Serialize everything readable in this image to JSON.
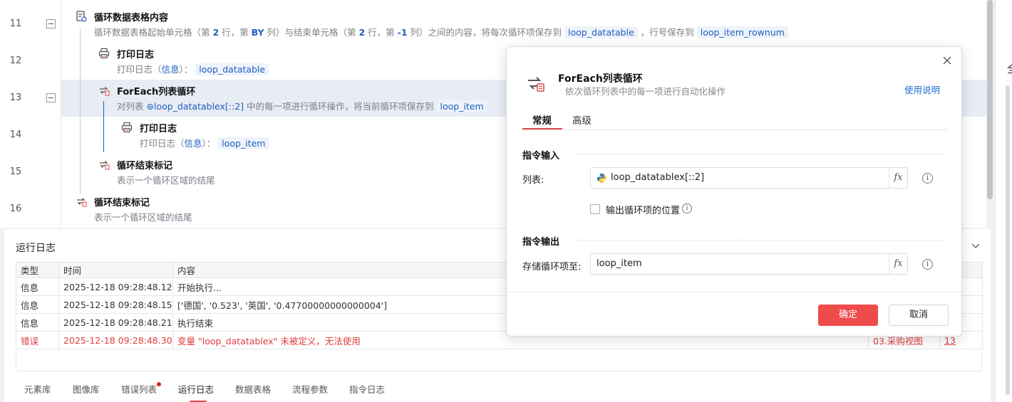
{
  "editor": {
    "line_numbers": [
      "11",
      "12",
      "13",
      "14",
      "15",
      "16"
    ],
    "steps": [
      {
        "title": "循环数据表格内容",
        "desc_parts": [
          "循环数据表格起始单元格（第 ",
          "2",
          " 行，第 ",
          "BY",
          " 列）与结束单元格（第 ",
          "2",
          " 行，第 ",
          "-1",
          " 列）之间的内容，将每次循环项保存到 ",
          "loop_datatable",
          " ，行号保存到 ",
          "loop_item_rownum"
        ]
      },
      {
        "title": "打印日志",
        "desc_prefix": "打印日志（",
        "desc_kw": "信息",
        "desc_mid": "）：",
        "desc_tag": "loop_datatable"
      },
      {
        "title": "ForEach列表循环",
        "desc_prefix": "对列表",
        "desc_tag1": "loop_datatablex[::2]",
        "desc_mid": " 中的每一项进行循环操作，将当前循环项保存到",
        "desc_tag2": "loop_item"
      },
      {
        "title": "打印日志",
        "desc_prefix": "打印日志（",
        "desc_kw": "信息",
        "desc_mid": "）：",
        "desc_tag": "loop_item"
      },
      {
        "title": "循环结束标记",
        "desc": "表示一个循环区域的结尾"
      },
      {
        "title": "循环结束标记",
        "desc": "表示一个循环区域的结尾"
      }
    ]
  },
  "right_pane": {
    "char": "全"
  },
  "log": {
    "title": "运行日志",
    "columns": [
      "类型",
      "时间",
      "内容"
    ],
    "rows": [
      {
        "type": "信息",
        "time": "2025-12-18 09:28:48.124",
        "content": "开始执行...",
        "extra1": "",
        "extra2": "",
        "error": false
      },
      {
        "type": "信息",
        "time": "2025-12-18 09:28:48.159",
        "content": "['德国', '0.523', '英国', '0.47700000000000004']",
        "extra1": "",
        "extra2": "",
        "error": false
      },
      {
        "type": "信息",
        "time": "2025-12-18 09:28:48.211",
        "content": "执行结束",
        "extra1": "",
        "extra2": "",
        "error": false
      },
      {
        "type": "错误",
        "time": "2025-12-18 09:28:48.307",
        "content": "变量 \"loop_datatablex\" 未被定义，无法使用",
        "extra1": "03.采购视图",
        "extra2": "13",
        "error": true
      }
    ],
    "tabs": [
      "元素库",
      "图像库",
      "错误列表",
      "运行日志",
      "数据表格",
      "流程参数",
      "指令日志"
    ],
    "active_tab": "运行日志"
  },
  "modal": {
    "title": "ForEach列表循环",
    "subtitle": "依次循环列表中的每一项进行自动化操作",
    "help_link": "使用说明",
    "tabs": [
      "常规",
      "高级"
    ],
    "section_input": "指令输入",
    "list_label": "列表:",
    "list_value": "loop_datatablex[::2]",
    "checkbox_label": "输出循环项的位置",
    "section_output": "指令输出",
    "store_label": "存储循环项至:",
    "store_value": "loop_item",
    "fx": "fx",
    "info": "i",
    "ok": "确定",
    "cancel": "取消"
  },
  "colors": {
    "accent_red": "#f04b4b",
    "link_blue": "#1f5fbf",
    "error_red": "#e03c3c",
    "highlight_row": "#e8ecf4"
  }
}
